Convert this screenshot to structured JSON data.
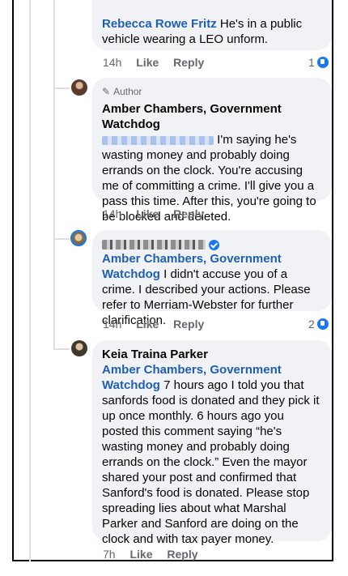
{
  "comments": [
    {
      "mention": "Rebecca Rowe Fritz",
      "text": " He's in a public vehicle wearing a LEO unform.",
      "time": "14h",
      "like": "Like",
      "reply": "Reply",
      "reactions": "1"
    },
    {
      "author_tag": "Author",
      "name": "Amber Chambers, Government Watchdog",
      "text": " I'm saying he's wasting money and probably doing errands on the clock. You're accusing me of committing a crime. I'll give you a pass this time. After this, you're going to be blocked and deleted.",
      "time": "14h",
      "like": "Like",
      "reply": "Reply"
    },
    {
      "mention": "Amber Chambers, Government Watchdog",
      "text": " I didn't accuse you of a crime. I described your actions. Please refer to Merriam-Webster for further clarification.",
      "time": "14h",
      "like": "Like",
      "reply": "Reply",
      "reactions": "2"
    },
    {
      "name": "Keia Traina Parker",
      "mention": "Amber Chambers, Government Watchdog",
      "text": " 7 hours ago I told you that sanfords food is donated and they pick it up once monthly. 6 hours ago you posted this comment saying “he's wasting money and probably doing errands on the clock.” Even the mayor shared your post and confirmed that Sanford's food is donated. Please stop spreading lies about what Marshal Parker and Sanford are doing on the clock and with tax payer money.",
      "time": "7h",
      "like": "Like",
      "reply": "Reply"
    }
  ],
  "colors": {
    "mention": "#1f5fb4",
    "bubble": "#f0f2f5",
    "meta": "#65676b",
    "like_badge": "#1877f2"
  }
}
